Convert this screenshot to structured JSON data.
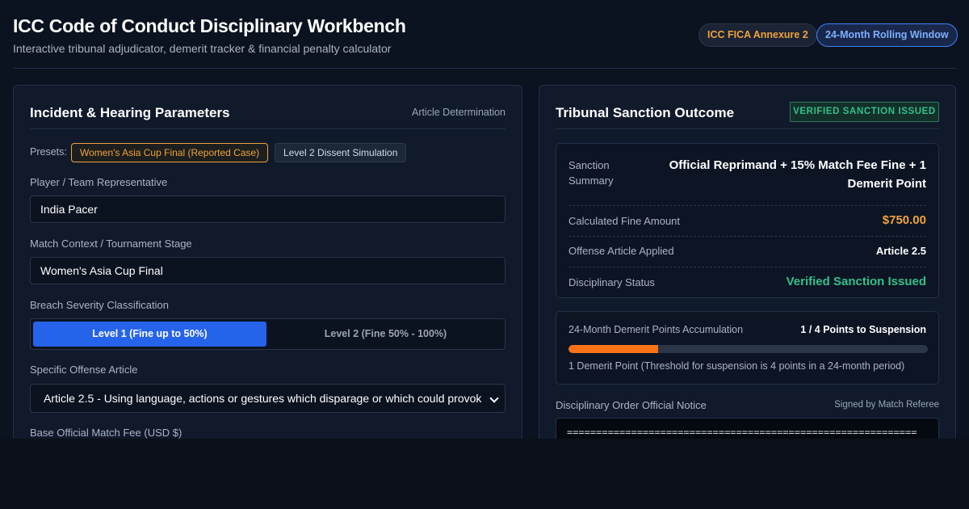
{
  "header": {
    "title": "ICC Code of Conduct Disciplinary Workbench",
    "subtitle": "Interactive tribunal adjudicator, demerit tracker & financial penalty calculator",
    "badges": [
      "ICC FICA Annexure 2",
      "24-Month Rolling Window"
    ]
  },
  "left": {
    "title": "Incident & Hearing Parameters",
    "tag": "Article Determination",
    "presets_label": "Presets:",
    "presets": [
      "Women's Asia Cup Final (Reported Case)",
      "Level 2 Dissent Simulation"
    ],
    "player_label": "Player / Team Representative",
    "player_value": "India Pacer",
    "match_label": "Match Context / Tournament Stage",
    "match_value": "Women's Asia Cup Final",
    "severity_label": "Breach Severity Classification",
    "severity_options": [
      "Level 1 (Fine up to 50%)",
      "Level 2 (Fine 50% - 100%)"
    ],
    "severity_selected": "Level 1 (Fine up to 50%)",
    "offense_label": "Specific Offense Article",
    "offense_value": "Article 2.5 - Using language, actions or gestures which disparage or which could provok",
    "fee_label": "Base Official Match Fee (USD $)"
  },
  "right": {
    "title": "Tribunal Sanction Outcome",
    "status_badge": "VERIFIED SANCTION ISSUED",
    "summary": {
      "sanction_label": "Sanction Summary",
      "sanction_value": "Official Reprimand + 15% Match Fee Fine + 1 Demerit Point",
      "fine_label": "Calculated Fine Amount",
      "fine_value": "$750.00",
      "article_label": "Offense Article Applied",
      "article_value": "Article 2.5",
      "status_label": "Disciplinary Status",
      "status_value": "Verified Sanction Issued"
    },
    "demerit": {
      "label": "24-Month Demerit Points Accumulation",
      "points_text": "1 / 4 Points to Suspension",
      "points": 1,
      "threshold": 4,
      "note": "1 Demerit Point (Threshold for suspension is 4 points in a 24-month period)"
    },
    "notice": {
      "label": "Disciplinary Order Official Notice",
      "signed": "Signed by Match Referee",
      "text": "============================================================"
    }
  },
  "colors": {
    "accent_blue": "#2563eb",
    "accent_orange": "#f0a23b",
    "success_green": "#34c08a",
    "progress_orange": "#f97316"
  }
}
